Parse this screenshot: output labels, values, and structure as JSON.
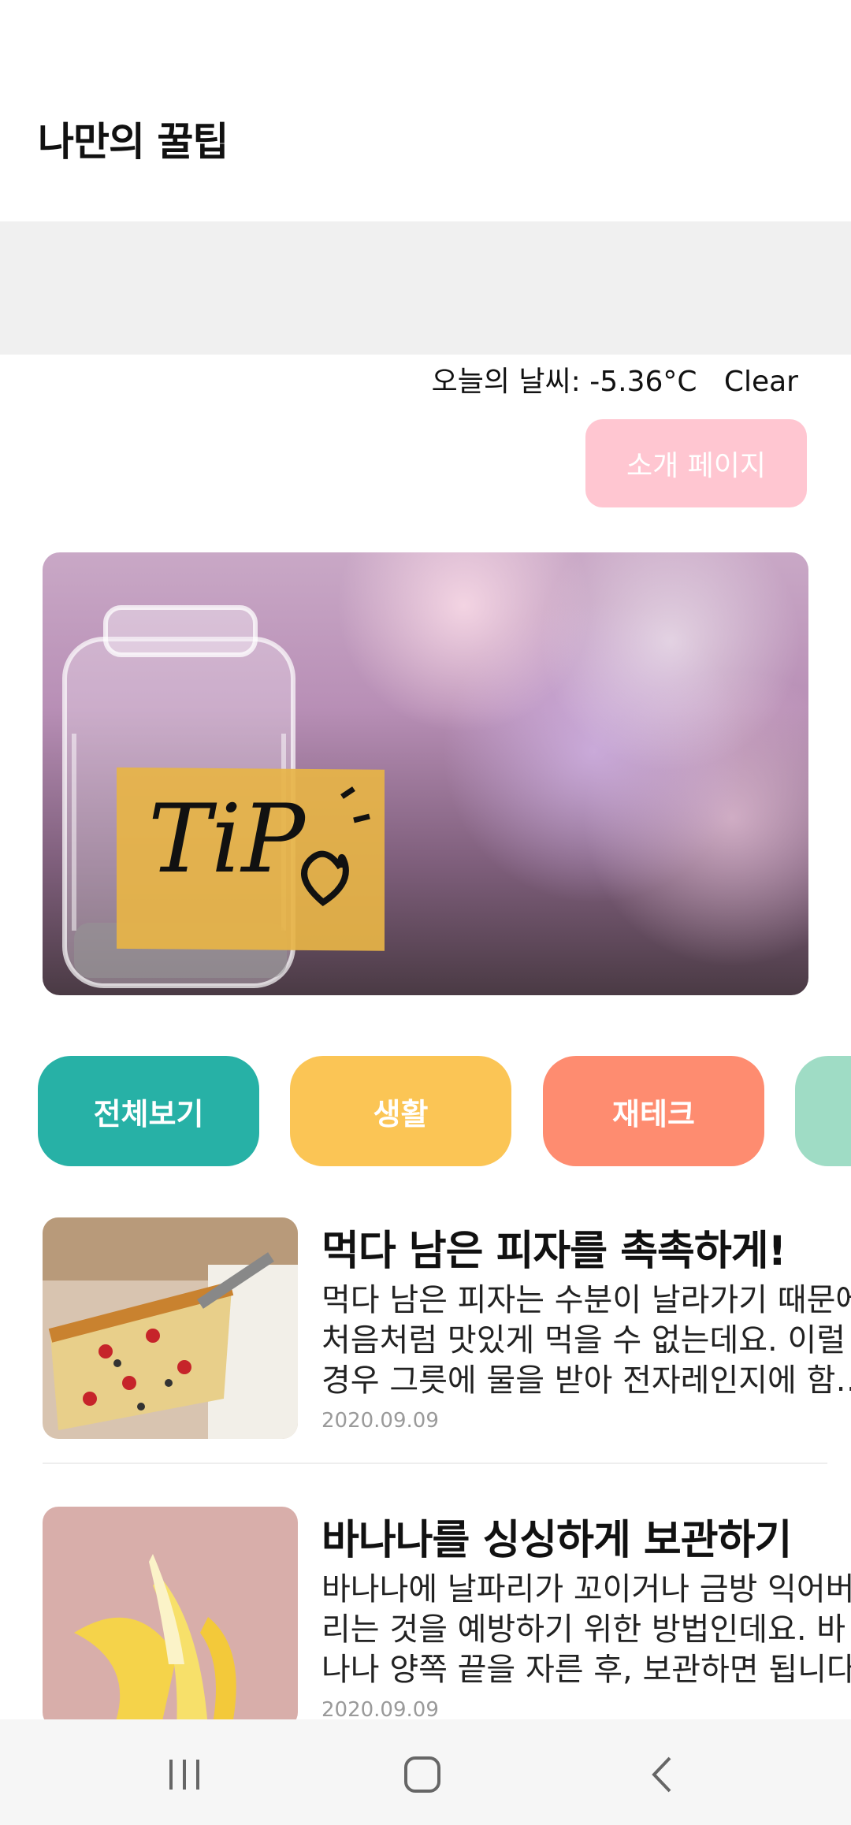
{
  "header": {
    "title": "나만의 꿀팁"
  },
  "weather": {
    "text": "오늘의 날씨: -5.36°C   Clear"
  },
  "intro_button": {
    "label": "소개 페이지"
  },
  "hero": {
    "label_text": "TiP"
  },
  "categories": [
    {
      "label": "전체보기",
      "color": "#27b1a6"
    },
    {
      "label": "생활",
      "color": "#fbc555"
    },
    {
      "label": "재테크",
      "color": "#fe8c70"
    },
    {
      "label": "",
      "color": "#9fdcc5"
    }
  ],
  "posts": [
    {
      "title": "먹다 남은 피자를 촉촉하게!",
      "body": "먹다 남은 피자는 수분이 날라가기 때문에 처음처럼 맛있게 먹을 수 없는데요. 이럴 경우 그릇에 물을 받아 전자레인지에 함께 돌려주면 촉촉해집니다.",
      "date": "2020.09.09",
      "thumb_icon": "pizza-photo"
    },
    {
      "title": "바나나를 싱싱하게 보관하기",
      "body": "바나나에 날파리가 꼬이거나 금방 익어버리는 것을 예방하기 위한 방법인데요. 바나나 양쪽 끝을 자른 후, 보관하면 됩니다.",
      "date": "2020.09.09",
      "thumb_icon": "banana-photo"
    }
  ],
  "navbar": {
    "items": [
      "recent-apps-icon",
      "home-icon",
      "back-icon"
    ]
  }
}
